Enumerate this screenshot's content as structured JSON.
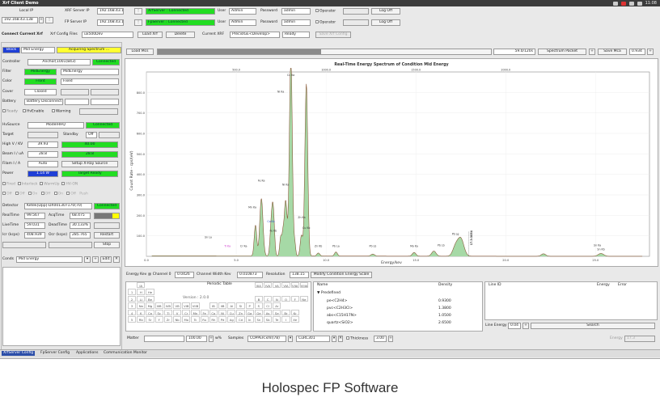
{
  "window": {
    "title": "Xrf Client Demo",
    "clock": "11:08"
  },
  "connection": {
    "local_ip_label": "Local IP",
    "local_ip": "192.168.43.138",
    "xrf_server_ip_label": "XRF Server IP",
    "xrf_server_ip": "192.168.43.1",
    "fp_server_ip_label": "FP Server IP",
    "fp_server_ip": "192.168.43.1",
    "xrf_status": "XrfServer : Connected",
    "fp_status": "FpServer : Connected",
    "user_label": "User",
    "user_xrf": "Admin",
    "user_fp": "Admin",
    "password_label": "Password",
    "password_xrf": "admin",
    "password_fp": "admin",
    "operator_label": "Operator",
    "logoff_label": "Log Off"
  },
  "toolbar": {
    "connect_label": "Connect Current Xrf",
    "config_files_label": "Xrf Config Files",
    "config_file": "ux500Dev",
    "load_label": "Load Xrf",
    "delete_label": "Delete",
    "current_label": "Current XRF",
    "current_xrf": "PrecisIGE<Develop>",
    "ready": "Ready",
    "save_config_label": "Save Xrf Config"
  },
  "status": {
    "mode": "Block",
    "energy": "Mid Energy",
    "state": "Acquiring Spectrum ..."
  },
  "controller": {
    "label": "Controller",
    "value": "Anchor[1001(843)",
    "status": "Connected",
    "filter_label": "Filter",
    "filter_value": "MidEnergy",
    "filter_select": "MidEnergy",
    "color_label": "Color",
    "color_value": "Front",
    "color_select": "Fixed",
    "cover_label": "Cover",
    "cover_value": "Closed",
    "battery_label": "Battery",
    "battery_value": "Battery Disconnect",
    "ready_label": "Ready",
    "hvenable_label": "HvEnable",
    "warning_label": "Warning"
  },
  "hv": {
    "label": "HvSource",
    "value": "ModelHHQ",
    "status": "Connected",
    "target_label": "Target",
    "standby_label": "Standby",
    "standby_value": "Off",
    "highv_label": "High V / KV",
    "highv_set": "39.93",
    "highv_read": "40.00",
    "beam_label": "Beam I / uA",
    "beam_set": "28.8",
    "beam_read": "28.8",
    "filam_label": "Filam I / A",
    "filam_set": "Auto",
    "setup_label": "Setup X-Ray Source",
    "power_label": "Power",
    "power_value": "1.14 W",
    "power_state": "Target Ready",
    "mode_labels": [
      "Fired",
      "Interlock",
      "WarmUp",
      "HV-ON"
    ],
    "ch_labels": [
      "Off",
      "Off",
      "On",
      "Off",
      "On",
      "Off",
      "Push"
    ]
  },
  "detector": {
    "label": "Detector",
    "value": "Ketek[Dpp]-DX001307170(70)",
    "status": "Connected",
    "realtime_label": "RealTime",
    "realtime": "99.567",
    "acqtime_label": "AcqTime",
    "acqtime": "68.475",
    "livetime_label": "LiveTime",
    "livetime": "59.031",
    "deadtime_label": "DeadTime",
    "deadtime": "30.133%",
    "icr_label": "Icr (kcps)",
    "icr": "408.939",
    "ocr_label": "Ocr (kcps)",
    "ocr": "285.765",
    "restart_label": "Restart",
    "stop_label": "Stop"
  },
  "conds": {
    "label": "Conds",
    "value": "Mid Energy",
    "edit_label": "Edit"
  },
  "spectrum": {
    "load_label": "Load Mcs",
    "progress_value": "59.0/120s",
    "progress_fraction": 0.49,
    "packet_label": "Spectrum Packet",
    "save_label": "Save Mca",
    "packet_value": "0.934"
  },
  "chart_data": {
    "type": "line",
    "title": "Real-Time Energy Spectrum of Condition Mid Energy",
    "xlabel": "Energy/kev",
    "ylabel": "Count Rate - cps/(eV)",
    "xlim": [
      0,
      28
    ],
    "ylim": [
      0,
      900
    ],
    "x_ticks": [
      "0.0",
      "5.0",
      "10.0",
      "15.0",
      "20.0",
      "25.0"
    ],
    "x_tick_values": [
      0,
      5,
      10,
      15,
      20,
      25
    ],
    "top_ticks": [
      "500.0",
      "1000.0",
      "1500.0",
      "2000.0"
    ],
    "top_tick_values": [
      5,
      10,
      15,
      20
    ],
    "y_ticks": [
      "800.0",
      "700.0",
      "600.0",
      "500.0",
      "400.0",
      "300.0",
      "200.0",
      "100.0"
    ],
    "y_tick_values": [
      800,
      700,
      600,
      500,
      400,
      300,
      200,
      100
    ],
    "peaks": [
      {
        "x": 6.07,
        "y": 150,
        "w": 0.07
      },
      {
        "x": 6.4,
        "y": 280,
        "w": 0.09
      },
      {
        "x": 6.95,
        "y": 140,
        "w": 0.07
      },
      {
        "x": 7.06,
        "y": 210,
        "w": 0.07
      },
      {
        "x": 7.48,
        "y": 95,
        "w": 0.06
      },
      {
        "x": 7.6,
        "y": 80,
        "w": 0.05
      },
      {
        "x": 7.75,
        "y": 270,
        "w": 0.08
      },
      {
        "x": 8.04,
        "y": 1000,
        "w": 0.08
      },
      {
        "x": 8.26,
        "y": 60,
        "w": 0.05
      },
      {
        "x": 8.63,
        "y": 100,
        "w": 0.07
      },
      {
        "x": 8.9,
        "y": 840,
        "w": 0.08
      },
      {
        "x": 9.57,
        "y": 15,
        "w": 0.08
      },
      {
        "x": 10.55,
        "y": 20,
        "w": 0.08
      },
      {
        "x": 12.6,
        "y": 10,
        "w": 0.1
      },
      {
        "x": 14.9,
        "y": 18,
        "w": 0.1
      },
      {
        "x": 16.0,
        "y": 25,
        "w": 0.12
      },
      {
        "x": 17.2,
        "y": 45,
        "w": 0.15
      },
      {
        "x": 17.5,
        "y": 85,
        "w": 0.17
      },
      {
        "x": 22.1,
        "y": 12,
        "w": 0.12
      },
      {
        "x": 25.3,
        "y": 14,
        "w": 0.15
      }
    ],
    "background": 3,
    "peak_labels": [
      {
        "text": "Cu Ka",
        "x": 8.04,
        "y": 880
      },
      {
        "text": "Ni Ka",
        "x": 7.48,
        "y": 800
      },
      {
        "text": "Fe Ka",
        "x": 6.4,
        "y": 365
      },
      {
        "text": "Ni Ka",
        "x": 7.75,
        "y": 345
      },
      {
        "text": "Mn Ka",
        "x": 5.9,
        "y": 235
      },
      {
        "text": "Co Ka",
        "x": 6.93,
        "y": 165
      },
      {
        "text": "Zn Ka",
        "x": 8.64,
        "y": 185
      },
      {
        "text": "Fe Kb",
        "x": 7.06,
        "y": 120
      },
      {
        "text": "Cu Kb",
        "x": 8.9,
        "y": 135
      },
      {
        "text": "Cr Ka",
        "x": 5.41,
        "y": 45
      },
      {
        "text": "Sn La",
        "x": 3.44,
        "y": 88
      },
      {
        "text": "Ti Ka",
        "x": 4.51,
        "y": 45
      },
      {
        "text": "Zn Kb",
        "x": 9.57,
        "y": 45
      },
      {
        "text": "Pb La",
        "x": 10.55,
        "y": 45
      },
      {
        "text": "Pb Lb",
        "x": 12.6,
        "y": 45
      },
      {
        "text": "Mo Ka",
        "x": 14.9,
        "y": 45
      },
      {
        "text": "Pb Lb",
        "x": 16.4,
        "y": 50
      },
      {
        "text": "Pb Lg",
        "x": 17.2,
        "y": 105
      },
      {
        "text": "17.3:3054",
        "x": 18.15,
        "y": 90
      },
      {
        "text": "Sn Ka",
        "x": 25.1,
        "y": 50
      },
      {
        "text": "Sn Kb",
        "x": 25.3,
        "y": 30
      }
    ]
  },
  "bottombar": {
    "energy_label": "Energy Kev @ Channel 0",
    "energy_value": "0.0426",
    "width_label": "Channel Width Kev",
    "width_value": "0.010873",
    "resolution_label": "Resolution",
    "resolution_value": "138.15",
    "modify_label": "Modify Condition Energy Scale"
  },
  "periodic": {
    "title": "Periodic Table",
    "version": "Version : 2.0.0",
    "col_ia": "IA",
    "col_iia": "IIA",
    "row1": [
      "H",
      "He"
    ],
    "row2": [
      "Li",
      "Be",
      "B",
      "C",
      "N",
      "O",
      "F",
      "Ne"
    ],
    "row3": [
      "Na",
      "Mg",
      "IIIB",
      "IVB",
      "VB",
      "VIB",
      "VIIB",
      "",
      "IB",
      "IIB",
      "Al",
      "Si",
      "P",
      "S",
      "Cl",
      "Ar"
    ],
    "row4": [
      "K",
      "Ca",
      "Sc",
      "Ti",
      "V",
      "Cr",
      "Mn",
      "Fe",
      "Co",
      "Ni",
      "Cu",
      "Zn",
      "Ga",
      "Ge",
      "As",
      "Se",
      "Br",
      "Kr"
    ],
    "row5": [
      "Rb",
      "Sr",
      "Y",
      "Zr",
      "Nb",
      "Mo",
      "Tc",
      "Ru",
      "Rh",
      "Pd",
      "Ag",
      "Cd",
      "In",
      "Sn",
      "Sb",
      "Te",
      "I",
      "Xe"
    ],
    "group_headers": [
      "IIIA",
      "IVA",
      "VA",
      "VIA",
      "VIIA",
      "VIIIA"
    ]
  },
  "matter": {
    "label": "Matter",
    "percent": "100.00",
    "unit": "w%",
    "samples_label": "Samples",
    "samples": "COPPER.xml(78)",
    "select": "CuRC301",
    "thickness_label": "Thickness",
    "thickness": "3.00"
  },
  "materials": {
    "name_header": "Name",
    "density_header": "Density",
    "group": "Predefined",
    "rows": [
      {
        "name": "pe<C2H4>",
        "density": "0.9300"
      },
      {
        "name": "pvc<C2H3Cl>",
        "density": "1.3800"
      },
      {
        "name": "abs<C15H17N>",
        "density": "1.0500"
      },
      {
        "name": "quartz<SiO2>",
        "density": "2.6500"
      }
    ]
  },
  "lines": {
    "id_header": "Line ID",
    "energy_header": "Energy",
    "error_header": "Error",
    "line_energy_label": "Line Energy",
    "line_energy": "0.04",
    "search_label": "Search",
    "energy_label": "Energy",
    "energy_value": "17.3"
  },
  "tabs": [
    "XrfServer Config",
    "FpServer Config",
    "Applications",
    "Communication Monitor"
  ],
  "caption": "Holospec FP Software"
}
